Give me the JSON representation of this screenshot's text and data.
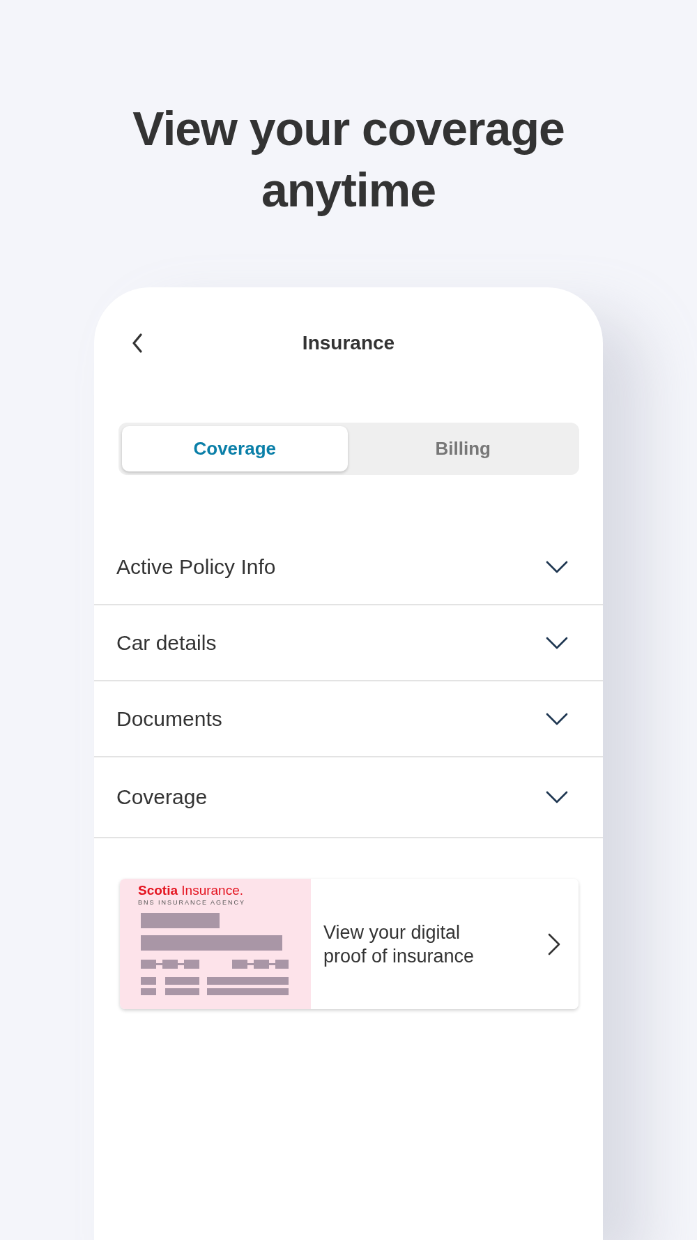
{
  "headline": "View your coverage anytime",
  "header": {
    "title": "Insurance"
  },
  "tabs": [
    {
      "label": "Coverage",
      "selected": true
    },
    {
      "label": "Billing",
      "selected": false
    }
  ],
  "sections": [
    {
      "label": "Active Policy Info",
      "expanded": false
    },
    {
      "label": "Car details",
      "expanded": false
    },
    {
      "label": "Documents",
      "expanded": false
    },
    {
      "label": "Coverage",
      "expanded": false
    }
  ],
  "proof_card": {
    "brand": "Scotia",
    "brand_suffix": "Insurance.",
    "agency": "BNS INSURANCE AGENCY",
    "text": "View your digital proof of insurance"
  }
}
